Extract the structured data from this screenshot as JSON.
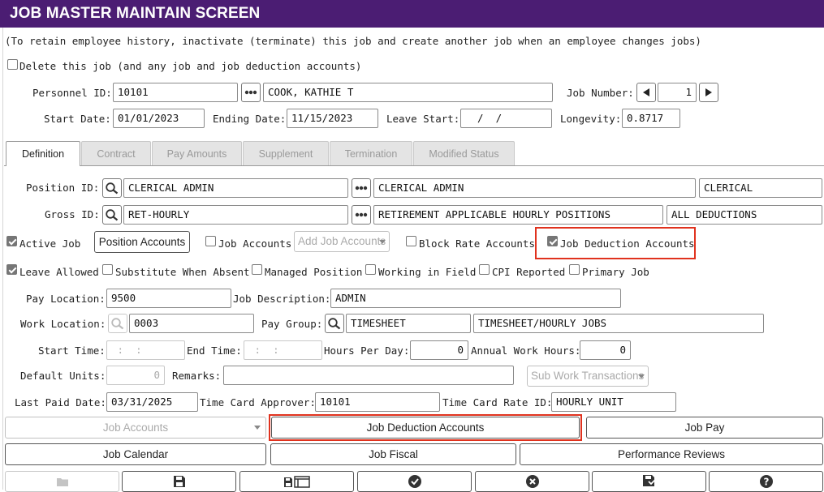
{
  "window": {
    "title": "JOB MASTER MAINTAIN SCREEN"
  },
  "notice": "(To retain employee history, inactivate (terminate) this job and create another job when an employee changes jobs)",
  "delete_job": {
    "label": "Delete this job (and any job and job deduction accounts)",
    "checked": false
  },
  "header": {
    "personnel_id_label": "Personnel ID:",
    "personnel_id": "10101",
    "employee_name": "COOK, KATHIE T",
    "job_number_label": "Job Number:",
    "job_number": "1",
    "start_date_label": "Start Date:",
    "start_date": "01/01/2023",
    "ending_date_label": "Ending Date:",
    "ending_date": "11/15/2023",
    "leave_start_label": "Leave Start:",
    "leave_start": "  /  /",
    "longevity_label": "Longevity:",
    "longevity": "0.8717"
  },
  "tabs": [
    {
      "label": "Definition",
      "active": true
    },
    {
      "label": "Contract",
      "active": false
    },
    {
      "label": "Pay Amounts",
      "active": false
    },
    {
      "label": "Supplement",
      "active": false
    },
    {
      "label": "Termination",
      "active": false
    },
    {
      "label": "Modified Status",
      "active": false
    }
  ],
  "definition": {
    "position_id_label": "Position ID:",
    "position_id": "CLERICAL ADMIN",
    "position_desc": "CLERICAL ADMIN",
    "position_class": "CLERICAL",
    "gross_id_label": "Gross ID:",
    "gross_id": "RET-HOURLY",
    "gross_desc": "RETIREMENT APPLICABLE HOURLY POSITIONS",
    "gross_deductions": "ALL DEDUCTIONS",
    "active_job_label": "Active Job",
    "position_accounts_button": "Position Accounts",
    "job_accounts_label": "Job Accounts",
    "add_job_accounts_placeholder": "Add Job Accounts",
    "block_rate_label": "Block Rate Accounts",
    "job_deduction_accounts_label": "Job Deduction Accounts",
    "leave_allowed_label": "Leave Allowed",
    "substitute_label": "Substitute When Absent",
    "managed_position_label": "Managed Position",
    "working_in_field_label": "Working in Field",
    "cpi_reported_label": "CPI Reported",
    "primary_job_label": "Primary Job",
    "pay_location_label": "Pay Location:",
    "pay_location": "9500",
    "job_description_label": "Job Description:",
    "job_description": "ADMIN",
    "work_location_label": "Work Location:",
    "work_location": "0003",
    "pay_group_label": "Pay Group:",
    "pay_group": "TIMESHEET",
    "pay_group_desc": "TIMESHEET/HOURLY JOBS",
    "start_time_label": "Start Time:",
    "start_time": " :  :",
    "end_time_label": "End Time:",
    "end_time": " :  :",
    "hours_per_day_label": "Hours Per Day:",
    "hours_per_day": "0",
    "annual_work_hours_label": "Annual Work Hours:",
    "annual_work_hours": "0",
    "default_units_label": "Default Units:",
    "default_units": "0",
    "remarks_label": "Remarks:",
    "remarks": "",
    "sub_work_transactions": "Sub Work Transactions",
    "last_paid_date_label": "Last Paid Date:",
    "last_paid_date": "03/31/2025",
    "time_card_approver_label": "Time Card Approver:",
    "time_card_approver": "10101",
    "time_card_rate_id_label": "Time Card Rate ID:",
    "time_card_rate_id": "HOURLY UNIT"
  },
  "action_buttons": {
    "job_accounts": "Job Accounts",
    "job_deduction_accounts": "Job Deduction Accounts",
    "job_pay": "Job Pay",
    "job_calendar": "Job Calendar",
    "job_fiscal": "Job Fiscal",
    "performance_reviews": "Performance Reviews"
  },
  "toolbar_icons": [
    "folder-icon",
    "save-icon",
    "save-print-icon",
    "check-icon",
    "cancel-icon",
    "save-download-icon",
    "help-icon"
  ],
  "colors": {
    "title_bar": "#4b1d73",
    "highlight": "#e0321e"
  }
}
